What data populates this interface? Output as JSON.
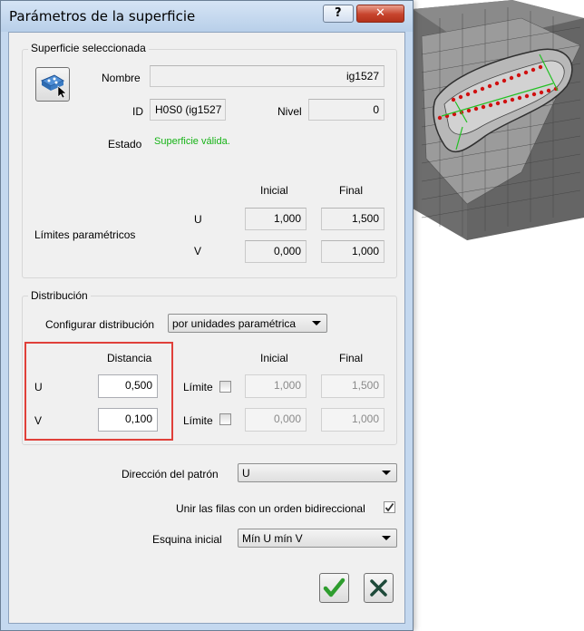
{
  "dialog": {
    "title": "Parámetros de la superficie",
    "help_glyph": "?",
    "close_glyph": "✕"
  },
  "surface_group": {
    "title": "Superficie seleccionada",
    "name_label": "Nombre",
    "name_value": "ig1527",
    "id_label": "ID",
    "id_value": "H0S0 (ig1527",
    "level_label": "Nivel",
    "level_value": "0",
    "state_label": "Estado",
    "state_value": "Superficie válida.",
    "param_limits_label": "Límites paramétricos",
    "initial_header": "Inicial",
    "final_header": "Final",
    "u_label": "U",
    "v_label": "V",
    "u_initial": "1,000",
    "u_final": "1,500",
    "v_initial": "0,000",
    "v_final": "1,000"
  },
  "distribution_group": {
    "title": "Distribución",
    "configure_label": "Configurar distribución",
    "configure_value": "por unidades paramétrica",
    "distance_header": "Distancia",
    "initial_header": "Inicial",
    "final_header": "Final",
    "u_label": "U",
    "v_label": "V",
    "u_distance": "0,500",
    "v_distance": "0,100",
    "limit_label": "Límite",
    "u_initial": "1,000",
    "u_final": "1,500",
    "v_initial": "0,000",
    "v_final": "1,000"
  },
  "pattern": {
    "direction_label": "Dirección del patrón",
    "direction_value": "U",
    "bidirectional_label": "Unir las filas con un orden bidireccional",
    "bidirectional_checked": true,
    "corner_label": "Esquina inicial",
    "corner_value": "Mín U mín V"
  },
  "buttons": {
    "ok_glyph": "✔",
    "cancel_glyph": "✕"
  },
  "colors": {
    "accent_red": "#e0403a",
    "status_green": "#16b316",
    "ok_green": "#2e9d2e"
  }
}
